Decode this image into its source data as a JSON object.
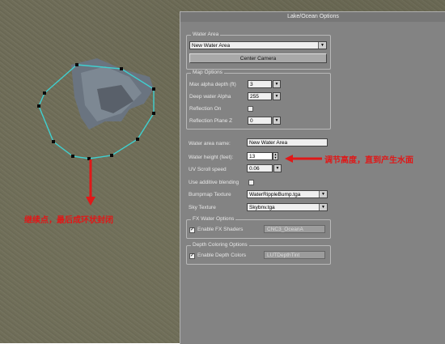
{
  "annotations": {
    "left_note": "继续点，最后成环状封闭",
    "right_note": "调节高度，直到产生水面"
  },
  "panel": {
    "title": "Lake/Ocean Options",
    "water_area": {
      "legend": "Water Area",
      "selected": "New Water Area",
      "center_button": "Center Camera"
    },
    "map_options": {
      "legend": "Map Options",
      "max_alpha_label": "Max alpha depth (ft)",
      "max_alpha_value": "3",
      "deep_alpha_label": "Deep water Alpha",
      "deep_alpha_value": "255",
      "reflection_on_label": "Reflection On",
      "reflection_plane_label": "Reflection Plane Z",
      "reflection_plane_value": "0"
    },
    "settings": {
      "name_label": "Water area name:",
      "name_value": "New Water Area",
      "height_label": "Water height (feet):",
      "height_value": "13",
      "uv_label": "UV Scroll speed",
      "uv_value": "0.06",
      "additive_label": "Use additive blending",
      "bumpmap_label": "Bumpmap Texture",
      "bumpmap_value": "WaterRippleBump.tga",
      "sky_label": "Sky Texture",
      "sky_value": "Skybnv.tga"
    },
    "fx": {
      "legend": "FX Water Options",
      "enable_label": "Enable FX Shaders",
      "shader_value": "CNC3_OceanA"
    },
    "depth": {
      "legend": "Depth Coloring Options",
      "enable_label": "Enable Depth Colors",
      "value": "LUTDepthTint"
    }
  }
}
